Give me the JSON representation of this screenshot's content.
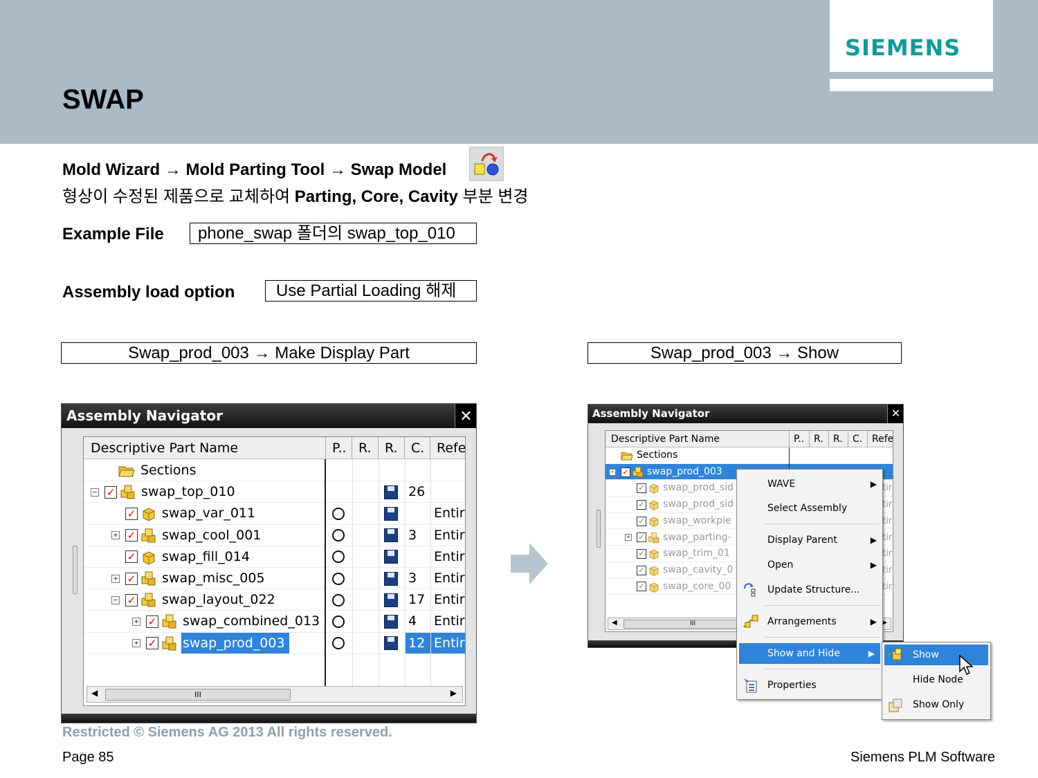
{
  "header": {
    "brand": "SIEMENS",
    "title": "SWAP"
  },
  "path": {
    "step1": "Mold Wizard",
    "step2": "Mold Parting Tool",
    "step3": "Swap Model",
    "arrow": "→"
  },
  "desc": {
    "pre": "형상이 수정된 제품으로 교체하여 ",
    "bold": "Parting, Core, Cavity",
    "post": " 부분 변경"
  },
  "example": {
    "label": "Example File",
    "value": "phone_swap 폴더의 swap_top_010"
  },
  "load": {
    "label": "Assembly load option",
    "value": "Use Partial Loading 해제"
  },
  "caption_left": "Swap_prod_003 → Make Display Part",
  "caption_right": "Swap_prod_003 → Show",
  "nav1": {
    "title": "Assembly Navigator",
    "close": "✕",
    "columns": [
      "Descriptive Part Name",
      "P..",
      "R.",
      "R.",
      "C.",
      "Refe"
    ],
    "rows": [
      {
        "name": "Sections",
        "count": "",
        "ref": ""
      },
      {
        "name": "swap_top_010",
        "count": "26",
        "ref": ""
      },
      {
        "name": "swap_var_011",
        "count": "",
        "ref": "Entire"
      },
      {
        "name": "swap_cool_001",
        "count": "3",
        "ref": "Entire"
      },
      {
        "name": "swap_fill_014",
        "count": "",
        "ref": "Entire"
      },
      {
        "name": "swap_misc_005",
        "count": "3",
        "ref": "Entire"
      },
      {
        "name": "swap_layout_022",
        "count": "17",
        "ref": "Entire"
      },
      {
        "name": "swap_combined_013",
        "count": "4",
        "ref": "Entire"
      },
      {
        "name": "swap_prod_003",
        "count": "12",
        "ref": "Entire"
      }
    ],
    "scroll_mark": "III"
  },
  "nav2": {
    "title": "Assembly Navigator",
    "close": "✕",
    "columns": [
      "Descriptive Part Name",
      "P..",
      "R.",
      "R.",
      "C.",
      "Refe"
    ],
    "rows": [
      {
        "name": "Sections"
      },
      {
        "name": "swap_prod_003"
      },
      {
        "name": "swap_prod_sid"
      },
      {
        "name": "swap_prod_sid"
      },
      {
        "name": "swap_workpie"
      },
      {
        "name": "swap_parting-"
      },
      {
        "name": "swap_trim_01"
      },
      {
        "name": "swap_cavity_0"
      },
      {
        "name": "swap_core_00"
      }
    ],
    "ref_short": "tir",
    "scroll_mark": "III"
  },
  "context_menu": {
    "items": [
      "WAVE",
      "Select Assembly",
      "Display Parent",
      "Open",
      "Update Structure...",
      "Arrangements",
      "Show and Hide",
      "Properties"
    ],
    "submenu": [
      "Show",
      "Hide Node",
      "Show Only"
    ]
  },
  "footer": {
    "restricted": "Restricted © Siemens AG 2013 All rights reserved.",
    "page": "Page 85",
    "company": "Siemens PLM Software"
  }
}
